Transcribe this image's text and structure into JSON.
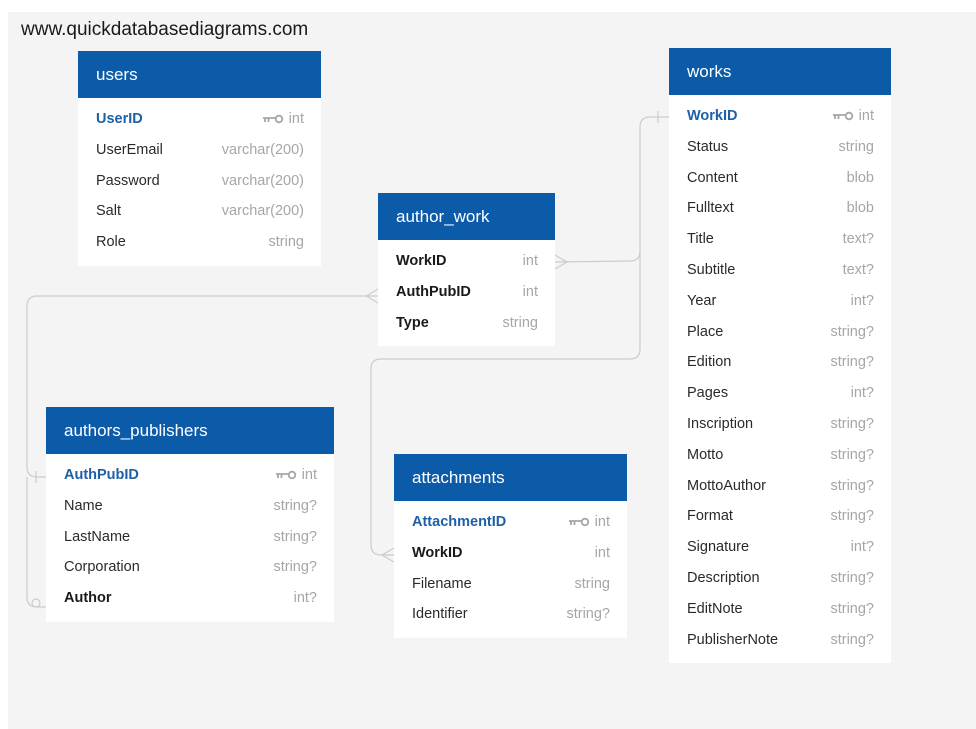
{
  "site_title": "www.quickdatabasediagrams.com",
  "colors": {
    "header": "#0b5ba8",
    "pk_text": "#1f5fa8",
    "type_text": "#a6a6a6",
    "connector": "#cccccc",
    "background": "#f4f4f4"
  },
  "tables": {
    "users": {
      "name": "users",
      "fields": [
        {
          "name": "UserID",
          "type": "int",
          "pk": true
        },
        {
          "name": "UserEmail",
          "type": "varchar(200)"
        },
        {
          "name": "Password",
          "type": "varchar(200)"
        },
        {
          "name": "Salt",
          "type": "varchar(200)"
        },
        {
          "name": "Role",
          "type": "string"
        }
      ]
    },
    "author_work": {
      "name": "author_work",
      "fields": [
        {
          "name": "WorkID",
          "type": "int",
          "fk": true
        },
        {
          "name": "AuthPubID",
          "type": "int",
          "fk": true
        },
        {
          "name": "Type",
          "type": "string",
          "fk": true
        }
      ]
    },
    "works": {
      "name": "works",
      "fields": [
        {
          "name": "WorkID",
          "type": "int",
          "pk": true
        },
        {
          "name": "Status",
          "type": "string"
        },
        {
          "name": "Content",
          "type": "blob"
        },
        {
          "name": "Fulltext",
          "type": "blob"
        },
        {
          "name": "Title",
          "type": "text?"
        },
        {
          "name": "Subtitle",
          "type": "text?"
        },
        {
          "name": "Year",
          "type": "int?"
        },
        {
          "name": "Place",
          "type": "string?"
        },
        {
          "name": "Edition",
          "type": "string?"
        },
        {
          "name": "Pages",
          "type": "int?"
        },
        {
          "name": "Inscription",
          "type": "string?"
        },
        {
          "name": "Motto",
          "type": "string?"
        },
        {
          "name": "MottoAuthor",
          "type": "string?"
        },
        {
          "name": "Format",
          "type": "string?"
        },
        {
          "name": "Signature",
          "type": "int?"
        },
        {
          "name": "Description",
          "type": "string?"
        },
        {
          "name": "EditNote",
          "type": "string?"
        },
        {
          "name": "PublisherNote",
          "type": "string?"
        }
      ]
    },
    "authors_publishers": {
      "name": "authors_publishers",
      "fields": [
        {
          "name": "AuthPubID",
          "type": "int",
          "pk": true
        },
        {
          "name": "Name",
          "type": "string?"
        },
        {
          "name": "LastName",
          "type": "string?"
        },
        {
          "name": "Corporation",
          "type": "string?"
        },
        {
          "name": "Author",
          "type": "int?",
          "fk": true
        }
      ]
    },
    "attachments": {
      "name": "attachments",
      "fields": [
        {
          "name": "AttachmentID",
          "type": "int",
          "pk": true
        },
        {
          "name": "WorkID",
          "type": "int",
          "fk": true
        },
        {
          "name": "Filename",
          "type": "string"
        },
        {
          "name": "Identifier",
          "type": "string?"
        }
      ]
    }
  },
  "relationships": [
    {
      "from": "author_work.WorkID",
      "to": "works.WorkID",
      "cardinality": "many-to-one"
    },
    {
      "from": "author_work.AuthPubID",
      "to": "authors_publishers.AuthPubID",
      "cardinality": "many-to-one"
    },
    {
      "from": "attachments.WorkID",
      "to": "works.WorkID",
      "cardinality": "many-to-one"
    },
    {
      "from": "authors_publishers.Author",
      "to": "authors_publishers.AuthPubID",
      "cardinality": "zero-or-one-to-one"
    }
  ]
}
